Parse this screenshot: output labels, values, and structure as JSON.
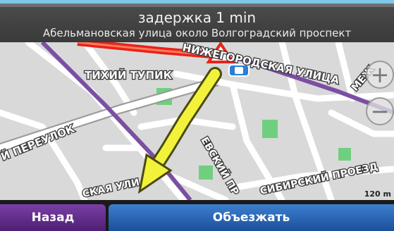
{
  "header": {
    "delay_text": "задержка 1 min",
    "street_info": "Абельмановская улица около Волгоградский проспект"
  },
  "map": {
    "streets": {
      "tikhiy_tupik": "ТИХИЙ ТУПИК",
      "nizhegorodskaya": "НИЖЕГОРОДСКАЯ УЛИЦА",
      "pereulok": "Й ПЕРЕУЛОК",
      "evsky_pr": "ЕВСКИЙ ПР",
      "skaya_uli": "СКАЯ УЛИ",
      "sibirsky_proezd": "СИБИРСКИЙ ПРОЕЗД",
      "mezh": "МЕЖ"
    },
    "scale_label": "120 m",
    "zoom_in_label": "+",
    "zoom_out_label": "−",
    "colors": {
      "incident_road": "#e8231a",
      "highway": "#7b4fa3",
      "route_arrow": "#f2f23a",
      "park": "#6fcf7f",
      "road": "#ffffff",
      "background": "#d9d9d9"
    }
  },
  "footer": {
    "back_label": "Назад",
    "detour_label": "Объезжать"
  }
}
